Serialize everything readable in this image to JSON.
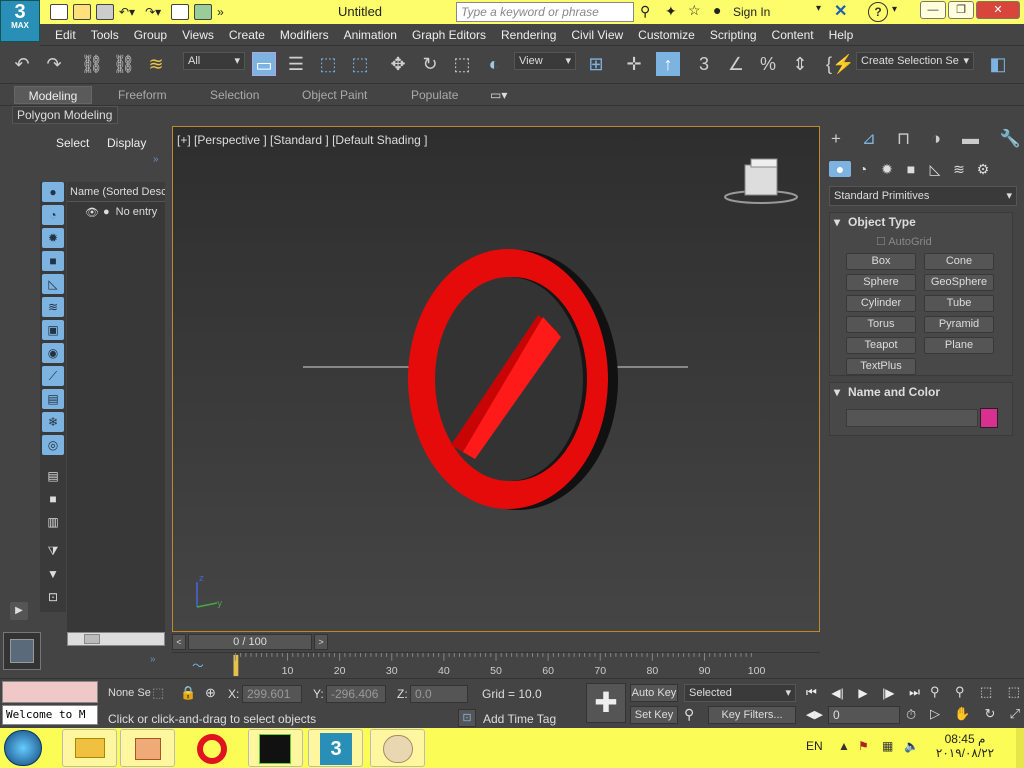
{
  "app": {
    "logo": "3",
    "logo_sub": "MAX",
    "title": "Untitled",
    "search_placeholder": "Type a keyword or phrase",
    "sign_in": "Sign In"
  },
  "menu": [
    "Edit",
    "Tools",
    "Group",
    "Views",
    "Create",
    "Modifiers",
    "Animation",
    "Graph Editors",
    "Rendering",
    "Civil View",
    "Customize",
    "Scripting",
    "Content",
    "Help"
  ],
  "toolbar": {
    "filter_select": "All",
    "view_select": "View",
    "selection_set": "Create Selection Se",
    "snap_count": "3"
  },
  "ribbon": {
    "tabs": [
      "Modeling",
      "Freeform",
      "Selection",
      "Object Paint",
      "Populate"
    ],
    "active_tab": "Modeling",
    "panel": "Polygon Modeling"
  },
  "scene_explorer": {
    "tabs": [
      "Select",
      "Display"
    ],
    "column_header": "Name (Sorted Desce",
    "entry": "No entry"
  },
  "viewport": {
    "label": "[+] [Perspective ] [Standard ] [Default Shading ]",
    "axis_z": "z",
    "axis_y": "y"
  },
  "command_panel": {
    "category": "Standard Primitives",
    "object_type_title": "Object Type",
    "autogrid": "AutoGrid",
    "buttons": [
      "Box",
      "Cone",
      "Sphere",
      "GeoSphere",
      "Cylinder",
      "Tube",
      "Torus",
      "Pyramid",
      "Teapot",
      "Plane",
      "TextPlus"
    ],
    "name_color_title": "Name and Color",
    "color": "#d8308f"
  },
  "timeline": {
    "frame": "0 / 100",
    "ticks": [
      "0",
      "10",
      "20",
      "30",
      "40",
      "50",
      "60",
      "70",
      "80",
      "90",
      "100"
    ]
  },
  "status": {
    "selection": "None Se",
    "x_label": "X:",
    "x_value": "299.601",
    "y_label": "Y:",
    "y_value": "-296.406",
    "z_label": "Z:",
    "z_value": "0.0",
    "grid": "Grid = 10.0",
    "prompt": "Click or click-and-drag to select objects",
    "add_time_tag": "Add Time Tag",
    "auto_key": "Auto Key",
    "set_key": "Set Key",
    "key_mode": "Selected",
    "key_filters": "Key Filters...",
    "frame_value": "0",
    "maxscript": "Welcome to M"
  },
  "taskbar": {
    "lang": "EN",
    "time": "08:45 م",
    "date": "٢٠١٩/٠٨/٢٢"
  }
}
